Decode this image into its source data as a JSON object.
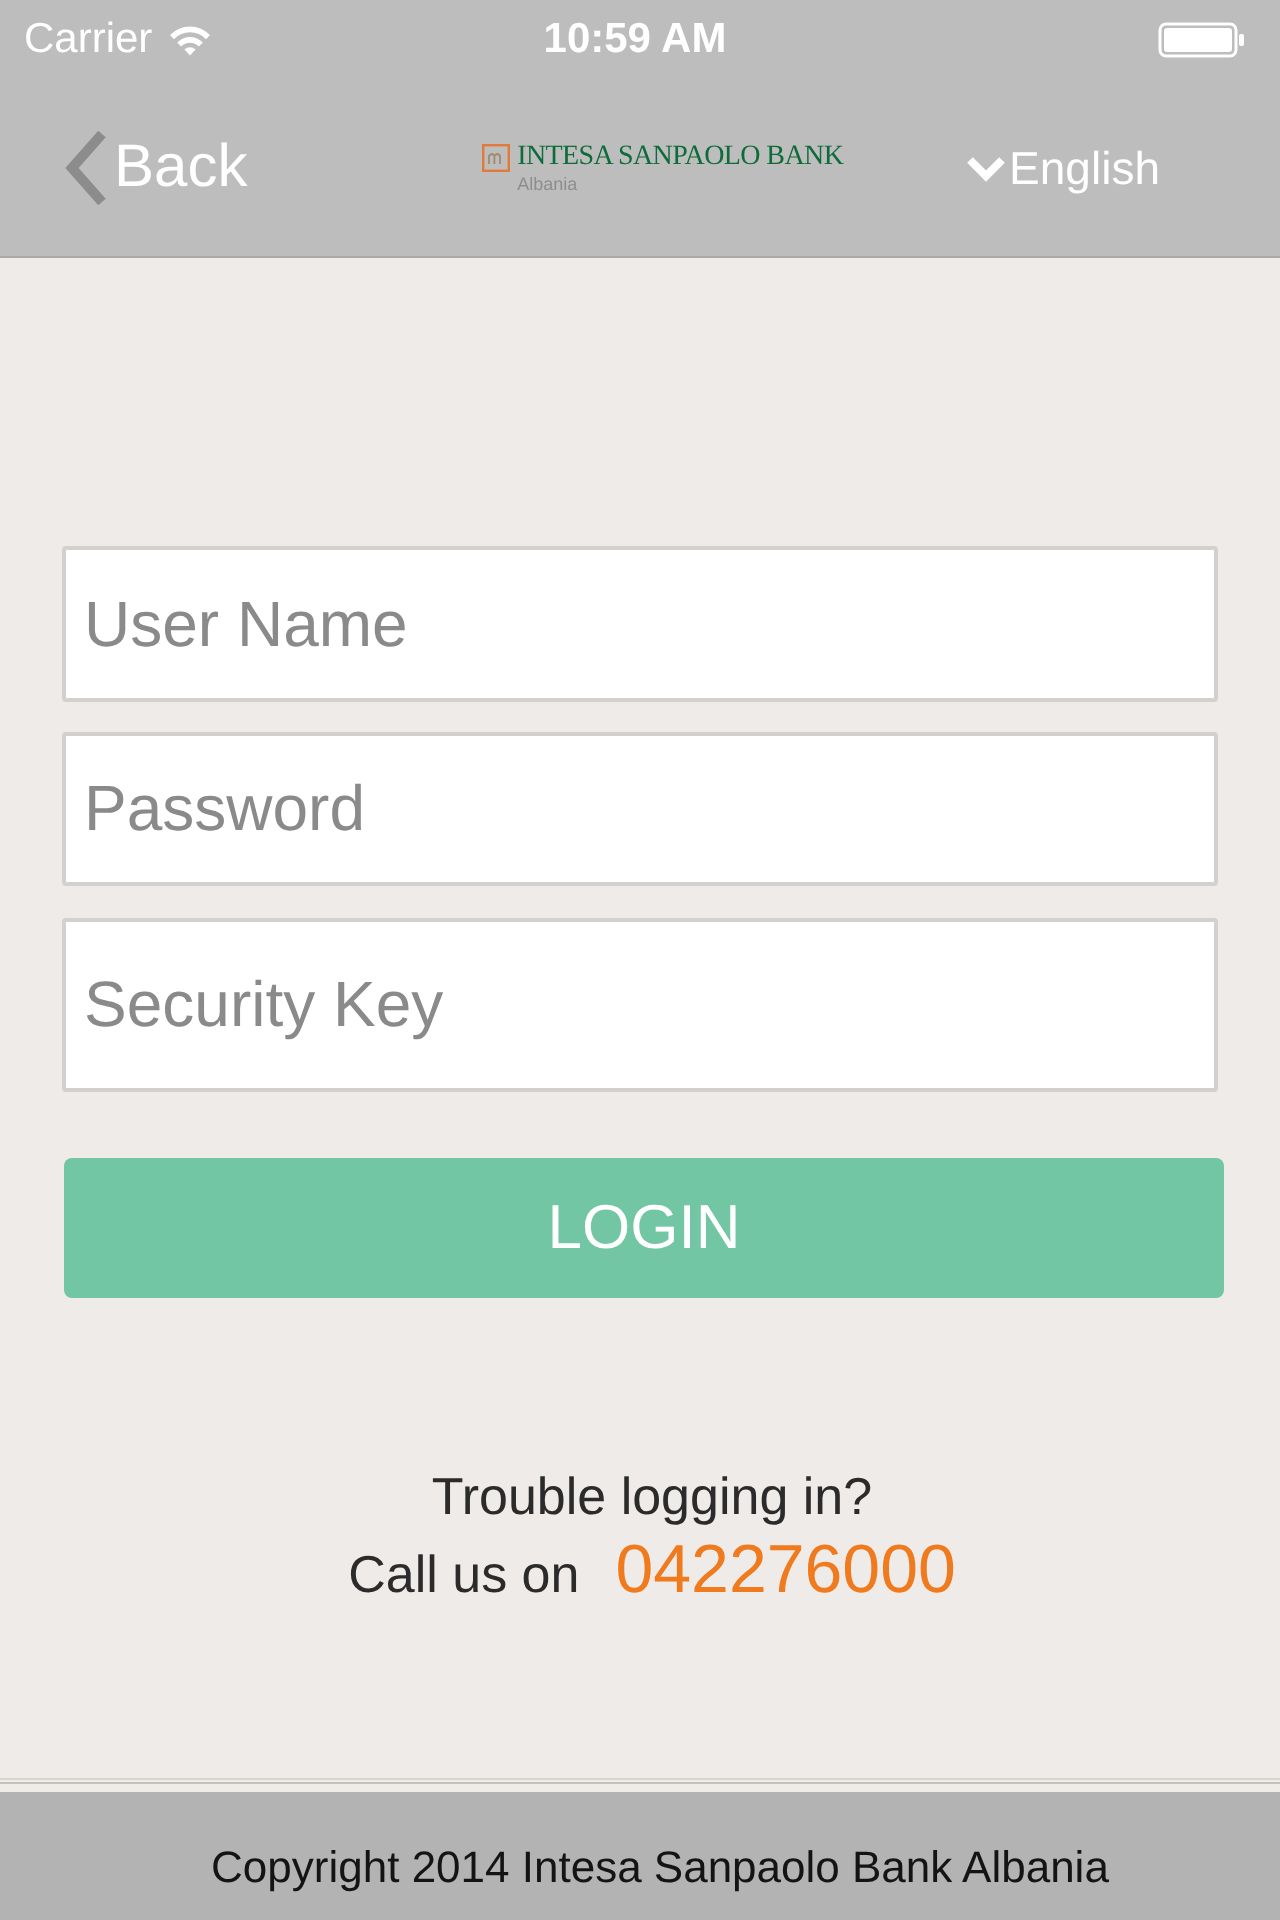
{
  "status_bar": {
    "carrier": "Carrier",
    "time": "10:59 AM"
  },
  "nav_bar": {
    "back": "Back",
    "logo": {
      "name": "INTESA SANPAOLO BANK",
      "subtitle": "Albania"
    },
    "language": "English"
  },
  "form": {
    "fields": [
      {
        "placeholder": "User Name"
      },
      {
        "placeholder": "Password"
      },
      {
        "placeholder": "Security Key"
      }
    ],
    "button": "LOGIN"
  },
  "help": {
    "question": "Trouble logging in?",
    "call_label": "Call us on",
    "phone": "042276000"
  },
  "footer": "Copyright 2014 Intesa Sanpaolo Bank Albania"
}
